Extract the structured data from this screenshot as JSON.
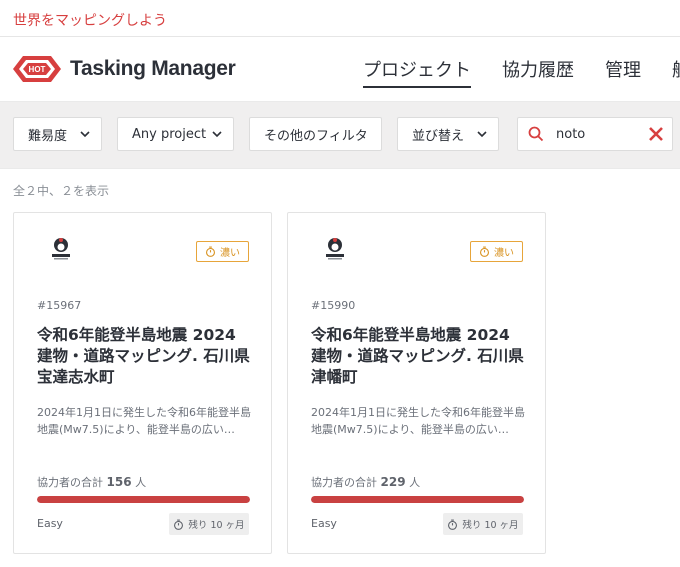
{
  "topbar": {
    "link": "世界をマッピングしよう"
  },
  "header": {
    "logo_badge": "HOT",
    "logo_text": "Tasking Manager",
    "nav": [
      "プロジェクト",
      "協力履歴",
      "管理",
      "航"
    ]
  },
  "filters": {
    "difficulty": "難易度",
    "project": "Any project",
    "other": "その他のフィルタ",
    "sort": "並び替え",
    "search_value": "noto"
  },
  "results": {
    "count_text": "全２中、２を表示"
  },
  "projects": [
    {
      "id": "#15967",
      "priority": "濃い",
      "title": "令和6年能登半島地震 2024 建物・道路マッピング. 石川県宝達志水町",
      "description": "2024年1月1日に発生した令和6年能登半島地震(Mw7.5)により、能登半島の広い…",
      "contributors_label": "協力者の合計",
      "contributors": "156",
      "contributors_unit": "人",
      "progress": 1.0,
      "difficulty": "Easy",
      "due": "残り 10 ヶ月"
    },
    {
      "id": "#15990",
      "priority": "濃い",
      "title": "令和6年能登半島地震 2024 建物・道路マッピング. 石川県津幡町",
      "description": "2024年1月1日に発生した令和6年能登半島地震(Mw7.5)により、能登半島の広い…",
      "contributors_label": "協力者の合計",
      "contributors": "229",
      "contributors_unit": "人",
      "progress": 1.0,
      "difficulty": "Easy",
      "due": "残り 10 ヶ月"
    }
  ],
  "colors": {
    "brand_red": "#d73f3f",
    "progress_red": "#c94141",
    "priority_orange": "#e7a53a"
  }
}
